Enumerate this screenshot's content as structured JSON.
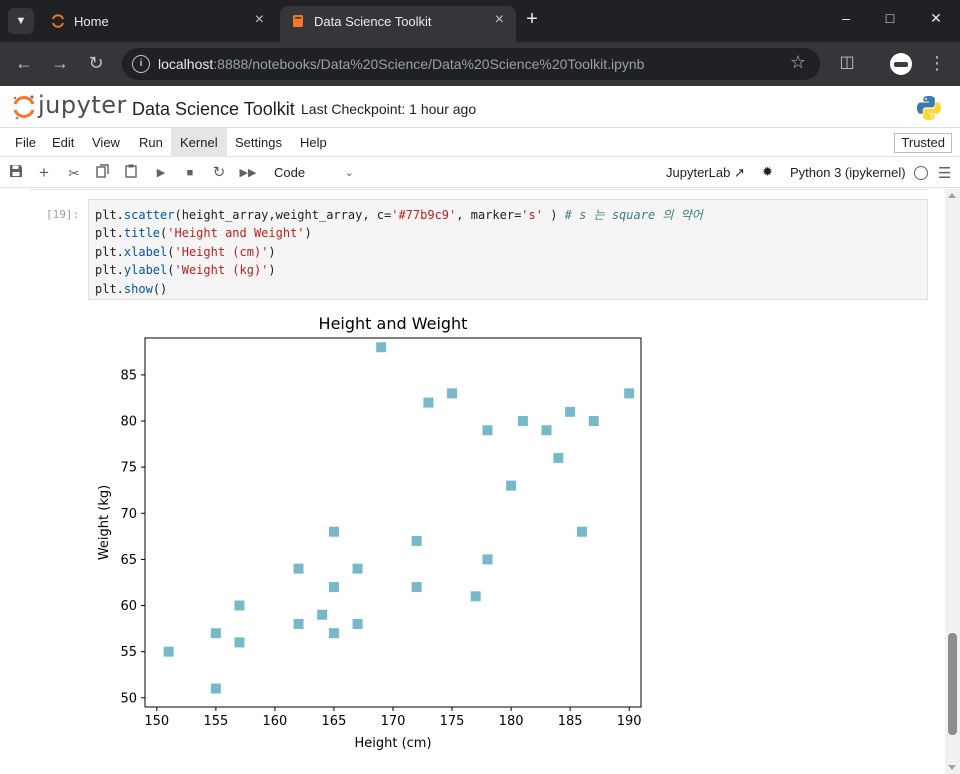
{
  "browser": {
    "tabs": [
      {
        "title": "Home",
        "icon": "jupyter-icon"
      },
      {
        "title": "Data Science Toolkit",
        "icon": "notebook-icon"
      }
    ],
    "url_host": "localhost",
    "url_rest": ":8888/notebooks/Data%20Science/Data%20Science%20Toolkit.ipynb"
  },
  "header": {
    "logo_text": "jupyter",
    "notebook_title": "Data Science Toolkit",
    "checkpoint": "Last Checkpoint: 1 hour ago"
  },
  "menu": {
    "items": [
      "File",
      "Edit",
      "View",
      "Run",
      "Kernel",
      "Settings",
      "Help"
    ],
    "trusted": "Trusted"
  },
  "toolbar": {
    "cell_type": "Code",
    "jupyterlab": "JupyterLab",
    "kernel": "Python 3 (ipykernel)"
  },
  "cell": {
    "prompt": "[19]:",
    "code": [
      {
        "pre": "plt.",
        "attr": "scatter",
        "mid": "(height_array,weight_array, c=",
        "str1": "'#77b9c9'",
        "mid2": ", marker=",
        "str2": "'s'",
        "post": " ) ",
        "comment": "# s 는 square 의 약어"
      },
      {
        "pre": "plt.",
        "attr": "title",
        "mid": "(",
        "str1": "'Height and Weight'",
        "post": ")"
      },
      {
        "pre": "plt.",
        "attr": "xlabel",
        "mid": "(",
        "str1": "'Height (cm)'",
        "post": ")"
      },
      {
        "pre": "plt.",
        "attr": "ylabel",
        "mid": "(",
        "str1": "'Weight (kg)'",
        "post": ")"
      },
      {
        "pre": "plt.",
        "attr": "show",
        "mid": "()"
      }
    ]
  },
  "chart_data": {
    "type": "scatter",
    "title": "Height and Weight",
    "xlabel": "Height (cm)",
    "ylabel": "Weight (kg)",
    "color": "#77b9c9",
    "marker": "square",
    "xlim": [
      149,
      191
    ],
    "ylim": [
      49,
      89
    ],
    "xticks": [
      150,
      155,
      160,
      165,
      170,
      175,
      180,
      185,
      190
    ],
    "yticks": [
      50,
      55,
      60,
      65,
      70,
      75,
      80,
      85
    ],
    "points": [
      [
        151,
        55
      ],
      [
        155,
        51
      ],
      [
        155,
        57
      ],
      [
        157,
        56
      ],
      [
        157,
        60
      ],
      [
        162,
        58
      ],
      [
        162,
        64
      ],
      [
        164,
        59
      ],
      [
        165,
        57
      ],
      [
        165,
        62
      ],
      [
        165,
        68
      ],
      [
        167,
        58
      ],
      [
        167,
        64
      ],
      [
        169,
        88
      ],
      [
        172,
        62
      ],
      [
        172,
        67
      ],
      [
        173,
        82
      ],
      [
        175,
        83
      ],
      [
        177,
        61
      ],
      [
        178,
        65
      ],
      [
        178,
        79
      ],
      [
        180,
        73
      ],
      [
        181,
        80
      ],
      [
        183,
        79
      ],
      [
        184,
        76
      ],
      [
        185,
        81
      ],
      [
        186,
        68
      ],
      [
        187,
        80
      ],
      [
        190,
        83
      ]
    ]
  }
}
